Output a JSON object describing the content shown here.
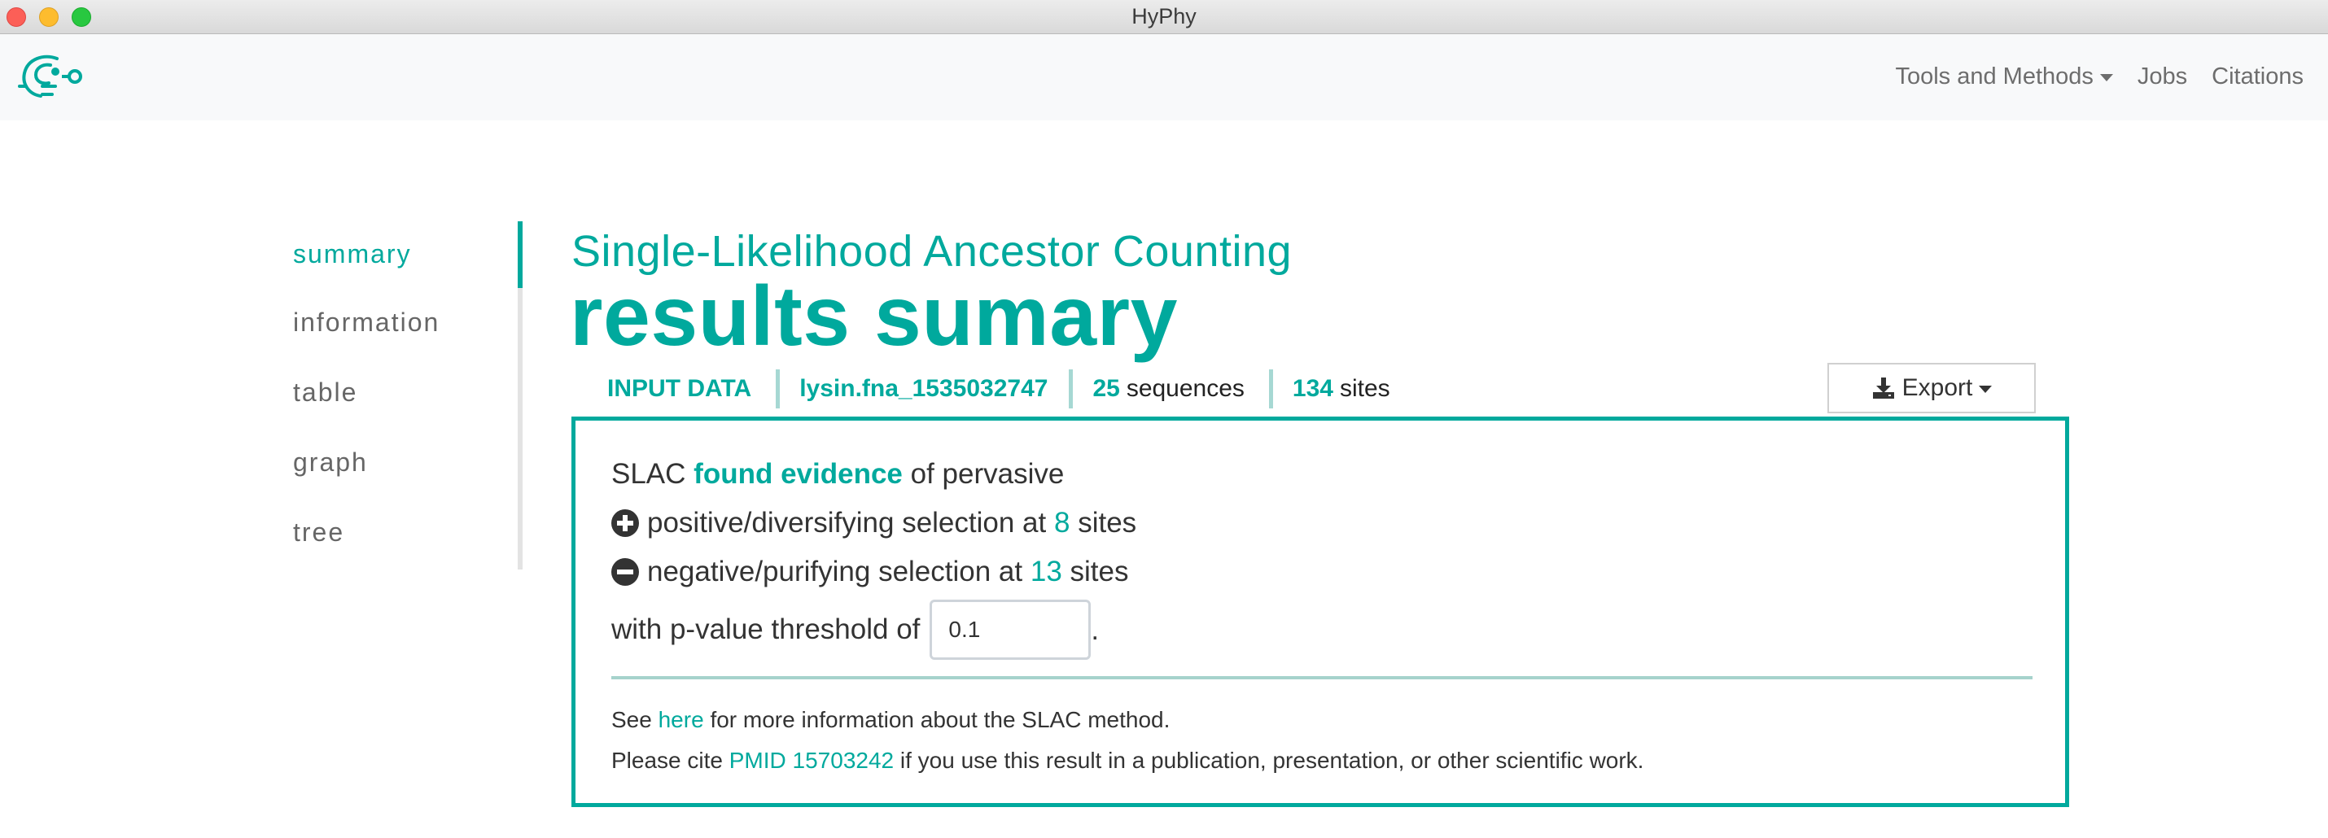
{
  "window": {
    "title": "HyPhy"
  },
  "navbar": {
    "logo_icon": "hyphy-logo-icon",
    "links": [
      {
        "label": "Tools and Methods",
        "dropdown": true
      },
      {
        "label": "Jobs"
      },
      {
        "label": "Citations"
      }
    ]
  },
  "sidebar": {
    "items": [
      {
        "label": "summary",
        "active": true
      },
      {
        "label": "information"
      },
      {
        "label": "table"
      },
      {
        "label": "graph"
      },
      {
        "label": "tree"
      }
    ]
  },
  "main": {
    "pre_title": "Single-Likelihood Ancestor Counting",
    "title": "results sumary",
    "input_data": {
      "label": "INPUT DATA",
      "filename": "lysin.fna_1535032747",
      "sequences_count": "25",
      "sequences_label": "sequences",
      "sites_count": "134",
      "sites_label": "sites"
    },
    "export": {
      "label": "Export",
      "icon": "download-icon"
    },
    "summary": {
      "lead_prefix": "SLAC",
      "lead_highlight": "found evidence",
      "lead_suffix": "of pervasive",
      "positive_text": "positive/diversifying selection at",
      "positive_count": "8",
      "positive_unit": "sites",
      "negative_text": "negative/purifying selection at",
      "negative_count": "13",
      "negative_unit": "sites",
      "pvalue_prefix": "with p-value threshold of",
      "pvalue_value": "0.1",
      "pvalue_suffix": "."
    },
    "footer": {
      "see_prefix": "See",
      "see_link": "here",
      "see_suffix": "for more information about the SLAC method.",
      "cite_prefix": "Please cite",
      "cite_link": "PMID 15703242",
      "cite_suffix": "if you use this result in a publication, presentation, or other scientific work."
    }
  },
  "colors": {
    "accent": "#00a99d",
    "text": "#333333",
    "nav_text": "#6d6d6d"
  }
}
